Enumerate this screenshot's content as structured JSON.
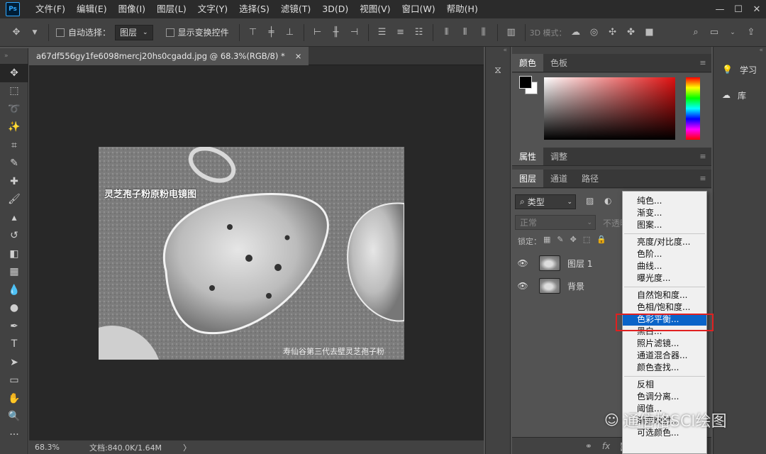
{
  "app": {
    "logo": "Ps"
  },
  "menu": [
    "文件(F)",
    "编辑(E)",
    "图像(I)",
    "图层(L)",
    "文字(Y)",
    "选择(S)",
    "滤镜(T)",
    "3D(D)",
    "视图(V)",
    "窗口(W)",
    "帮助(H)"
  ],
  "options": {
    "auto_select_label": "自动选择：",
    "auto_select_value": "图层",
    "show_transform_label": "显示变换控件",
    "mode3d_label": "3D 模式："
  },
  "document": {
    "tab_title": "a67df556gy1fe6098mercj20hs0cgadd.jpg @ 68.3%(RGB/8) *",
    "close": "×"
  },
  "image": {
    "title": "灵芝孢子粉原粉电镜图",
    "watermark": "寿仙谷第三代去壁灵芝孢子粉"
  },
  "status": {
    "zoom": "68.3%",
    "doc_info": "文档:840.0K/1.64M",
    "arrow": "〉"
  },
  "panels": {
    "color_tabs": [
      "颜色",
      "色板"
    ],
    "props_tabs": [
      "属性",
      "调整"
    ],
    "layers_tabs": [
      "图层",
      "通道",
      "路径"
    ],
    "filter_kind": "类型",
    "blend_mode": "正常",
    "opacity_label": "不透明",
    "lock_label": "锁定：",
    "layers": [
      {
        "name": "图层 1"
      },
      {
        "name": "背景"
      }
    ]
  },
  "sidebar": {
    "learn": "学习",
    "library": "库"
  },
  "context_menu": {
    "groups": [
      [
        "纯色...",
        "渐变...",
        "图案..."
      ],
      [
        "亮度/对比度...",
        "色阶...",
        "曲线...",
        "曝光度..."
      ],
      [
        "自然饱和度...",
        "色相/饱和度...",
        "色彩平衡...",
        "黑白...",
        "照片滤镜...",
        "通道混合器...",
        "颜色查找..."
      ],
      [
        "反相",
        "色调分离...",
        "阈值...",
        "渐变映射...",
        "可选颜色..."
      ]
    ],
    "highlighted": "色彩平衡..."
  },
  "watermark": {
    "text": "通信格SCI绘图"
  },
  "colors": {
    "accent": "#0a64c8",
    "highlight_box": "#e02020",
    "fg": "#000000",
    "bg": "#ffffff"
  }
}
